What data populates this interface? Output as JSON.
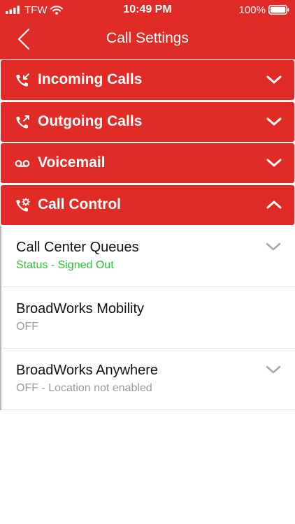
{
  "status_bar": {
    "carrier": "TFW",
    "time": "10:49 PM",
    "battery": "100%"
  },
  "nav": {
    "title": "Call Settings"
  },
  "sections": [
    {
      "label": "Incoming Calls",
      "icon": "incoming-call-icon",
      "expanded": false
    },
    {
      "label": "Outgoing Calls",
      "icon": "outgoing-call-icon",
      "expanded": false
    },
    {
      "label": "Voicemail",
      "icon": "voicemail-icon",
      "expanded": false
    },
    {
      "label": "Call Control",
      "icon": "call-control-icon",
      "expanded": true
    }
  ],
  "call_control_items": [
    {
      "title": "Call Center Queues",
      "subtitle": "Status - Signed Out",
      "has_chevron": true
    },
    {
      "title": "BroadWorks Mobility",
      "subtitle": "OFF",
      "has_chevron": false
    },
    {
      "title": "BroadWorks Anywhere",
      "subtitle": "OFF - Location not enabled",
      "has_chevron": true
    }
  ],
  "colors": {
    "brand_red": "#e12b27",
    "status_green": "#2cbf3a",
    "secondary_text": "#9a9a9a"
  }
}
